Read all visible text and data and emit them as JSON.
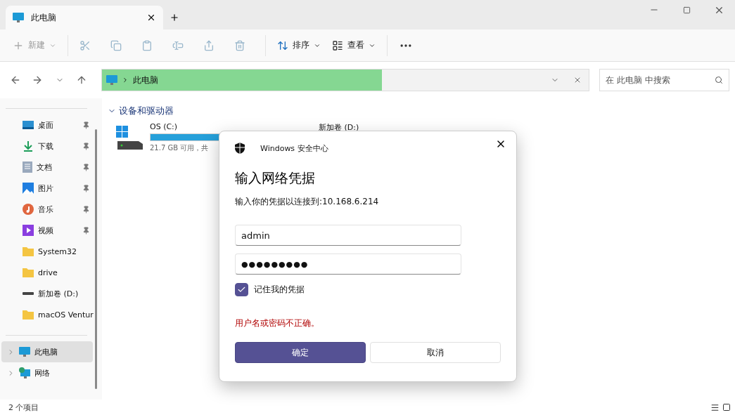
{
  "tabs": [
    {
      "label": "此电脑",
      "selected": true
    }
  ],
  "toolbar": [
    {
      "kind": "new",
      "label": "新建",
      "disabled": true
    },
    {
      "kind": "cut",
      "disabled": true
    },
    {
      "kind": "copy",
      "disabled": true
    },
    {
      "kind": "paste",
      "disabled": true
    },
    {
      "kind": "rename",
      "disabled": true
    },
    {
      "kind": "share",
      "disabled": true
    },
    {
      "kind": "delete",
      "disabled": true
    },
    {
      "kind": "sort",
      "label": "排序",
      "disabled": false
    },
    {
      "kind": "view",
      "label": "查看",
      "disabled": false
    },
    {
      "kind": "more",
      "disabled": false
    }
  ],
  "address_bar": {
    "location": "此电脑",
    "level": 0.575
  },
  "search": {
    "placeholder": "在 此电脑 中搜索"
  },
  "sidebar": {
    "quick_access": [
      {
        "kind": "desktop",
        "label": "桌面",
        "pinned": true
      },
      {
        "kind": "download",
        "label": "下载",
        "pinned": true
      },
      {
        "kind": "document",
        "label": "文档",
        "pinned": true
      },
      {
        "kind": "picture",
        "label": "图片",
        "pinned": true
      },
      {
        "kind": "music",
        "label": "音乐",
        "pinned": true
      },
      {
        "kind": "video",
        "label": "视频",
        "pinned": true
      },
      {
        "kind": "folder",
        "label": "System32",
        "pinned": false
      },
      {
        "kind": "folder",
        "label": "drive",
        "pinned": false
      },
      {
        "kind": "drive",
        "label": "新加卷 (D:)",
        "pinned": false
      },
      {
        "kind": "folder",
        "label": "macOS Ventur",
        "pinned": false
      }
    ],
    "tree": [
      {
        "kind": "pc",
        "label": "此电脑",
        "selected": true
      },
      {
        "kind": "network",
        "label": "网络",
        "selected": false
      }
    ]
  },
  "section": {
    "title": "设备和驱动器",
    "expanded": true,
    "drives": [
      {
        "kind": "system",
        "name": "OS (C:)",
        "detail": "21.7 GB 可用，共"
      },
      {
        "kind": "plain",
        "name": "新加卷 (D:)"
      }
    ]
  },
  "status_bar": {
    "count": "2 个项目"
  },
  "dialog": {
    "app": "Windows 安全中心",
    "title": "输入网络凭据",
    "subtitle": "输入你的凭据以连接到:10.168.6.214",
    "username": "admin",
    "password": "●●●●●●●●●",
    "remember": {
      "label": "记住我的凭据",
      "checked": true
    },
    "error": "用户名或密码不正确。",
    "ok": "确定",
    "cancel": "取消"
  }
}
